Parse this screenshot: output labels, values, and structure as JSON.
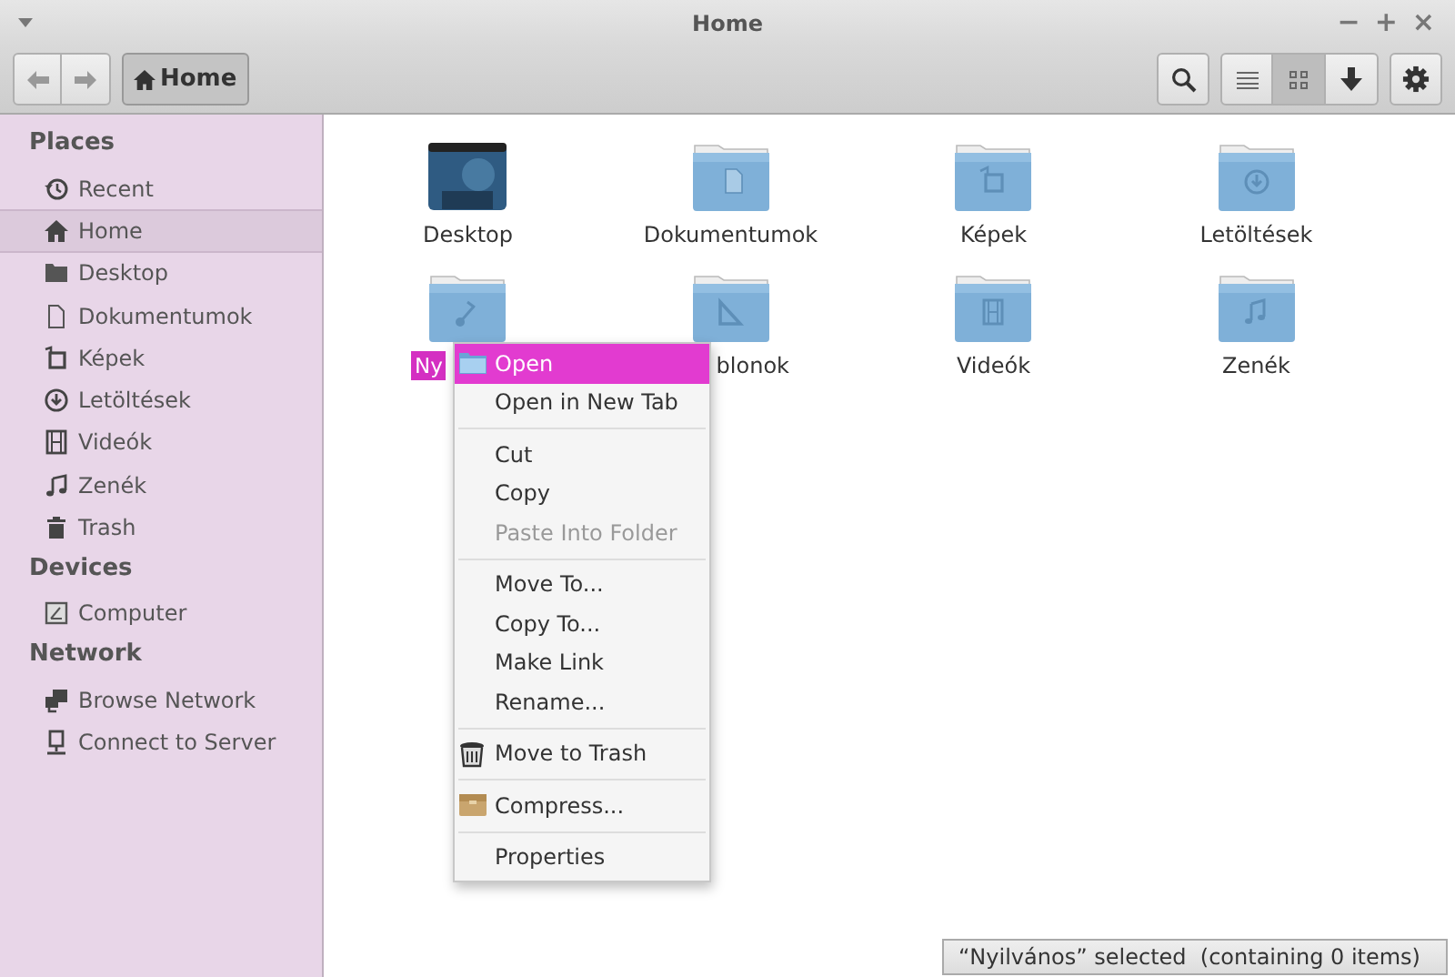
{
  "window": {
    "title": "Home",
    "controls": [
      "−",
      "+",
      "×"
    ]
  },
  "toolbar": {
    "path_button": {
      "label": "Home"
    },
    "view_buttons": [
      {
        "kind": "list",
        "selected": false
      },
      {
        "kind": "grid",
        "selected": true
      },
      {
        "kind": "sort",
        "selected": false
      }
    ]
  },
  "sidebar": {
    "sections": [
      {
        "heading": "Places",
        "items": [
          {
            "label": "Recent",
            "selected": false
          },
          {
            "label": "Home",
            "selected": true
          },
          {
            "label": "Desktop",
            "selected": false
          },
          {
            "label": "Dokumentumok",
            "selected": false
          },
          {
            "label": "Képek",
            "selected": false
          },
          {
            "label": "Letöltések",
            "selected": false
          },
          {
            "label": "Videók",
            "selected": false
          },
          {
            "label": "Zenék",
            "selected": false
          },
          {
            "label": "Trash",
            "selected": false
          }
        ]
      },
      {
        "heading": "Devices",
        "items": [
          {
            "label": "Computer",
            "selected": false
          }
        ]
      },
      {
        "heading": "Network",
        "items": [
          {
            "label": "Browse Network",
            "selected": false
          },
          {
            "label": "Connect to Server",
            "selected": false
          }
        ]
      }
    ]
  },
  "files": [
    {
      "kind": "desktop",
      "label": "Desktop",
      "selected": false
    },
    {
      "kind": "folder",
      "label": "Dokumentumok",
      "selected": false
    },
    {
      "kind": "folder",
      "label": "Képek",
      "selected": false
    },
    {
      "kind": "folder",
      "label": "Letöltések",
      "selected": false
    },
    {
      "kind": "folder",
      "label": "Ny",
      "selected": true
    },
    {
      "kind": "folder",
      "label": "blonok",
      "selected": false
    },
    {
      "kind": "folder",
      "label": "Videók",
      "selected": false
    },
    {
      "kind": "folder",
      "label": "Zenék",
      "selected": false
    }
  ],
  "context_menu": [
    {
      "kind": "item",
      "label": "Open",
      "selected": true,
      "disabled": false
    },
    {
      "kind": "item",
      "label": "Open in New Tab",
      "selected": false,
      "disabled": false
    },
    {
      "kind": "separator"
    },
    {
      "kind": "item",
      "label": "Cut",
      "selected": false,
      "disabled": false
    },
    {
      "kind": "item",
      "label": "Copy",
      "selected": false,
      "disabled": false
    },
    {
      "kind": "item",
      "label": "Paste Into Folder",
      "selected": false,
      "disabled": true
    },
    {
      "kind": "separator"
    },
    {
      "kind": "item",
      "label": "Move To...",
      "selected": false,
      "disabled": false
    },
    {
      "kind": "item",
      "label": "Copy To...",
      "selected": false,
      "disabled": false
    },
    {
      "kind": "item",
      "label": "Make Link",
      "selected": false,
      "disabled": false
    },
    {
      "kind": "item",
      "label": "Rename...",
      "selected": false,
      "disabled": false
    },
    {
      "kind": "separator"
    },
    {
      "kind": "item",
      "label": "Move to Trash",
      "selected": false,
      "disabled": false
    },
    {
      "kind": "separator"
    },
    {
      "kind": "item",
      "label": "Compress...",
      "selected": false,
      "disabled": false
    },
    {
      "kind": "separator"
    },
    {
      "kind": "item",
      "label": "Properties",
      "selected": false,
      "disabled": false
    }
  ],
  "status_bar": "“Nyilvános” selected  (containing 0 items)"
}
